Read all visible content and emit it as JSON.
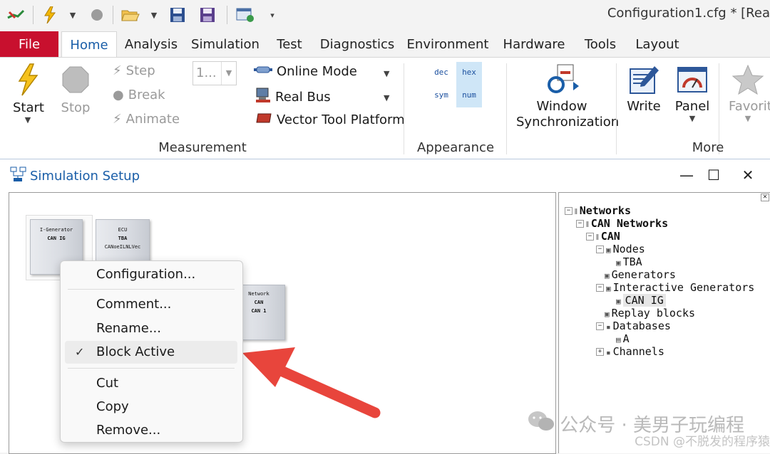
{
  "window": {
    "title": "Configuration1.cfg * [Rea"
  },
  "ribbon_tabs": [
    "File",
    "Home",
    "Analysis",
    "Simulation",
    "Test",
    "Diagnostics",
    "Environment",
    "Hardware",
    "Tools",
    "Layout"
  ],
  "measurement": {
    "start": "Start",
    "stop": "Stop",
    "step": "Step",
    "break": "Break",
    "animate": "Animate",
    "step_value": "1...",
    "online_mode": "Online Mode",
    "real_bus": "Real Bus",
    "vector_tool_platform": "Vector Tool Platform",
    "group": "Measurement"
  },
  "appearance": {
    "dec": "dec",
    "hex": "hex",
    "sym": "sym",
    "num": "num",
    "group": "Appearance"
  },
  "more": {
    "window_sync_1": "Window",
    "window_sync_2": "Synchronization",
    "write": "Write",
    "panel": "Panel",
    "favorites": "Favorite",
    "group": "More"
  },
  "sim_window": {
    "title": "Simulation Setup"
  },
  "blocks": {
    "igen": {
      "l1": "I-Generator",
      "l2": "CAN IG"
    },
    "ecu": {
      "l1": "ECU",
      "l2": "TBA",
      "l3": "CANoeILNLVec"
    },
    "network": {
      "l1": "Network",
      "l2": "CAN",
      "l3": "CAN 1"
    }
  },
  "context_menu": {
    "configuration": "Configuration...",
    "comment": "Comment...",
    "rename": "Rename...",
    "block_active": "Block Active",
    "cut": "Cut",
    "copy": "Copy",
    "remove": "Remove..."
  },
  "tree": {
    "networks": "Networks",
    "can_networks": "CAN Networks",
    "can": "CAN",
    "nodes": "Nodes",
    "tba": "TBA",
    "generators": "Generators",
    "interactive_generators": "Interactive Generators",
    "can_ig": "CAN IG",
    "replay_blocks": "Replay blocks",
    "databases": "Databases",
    "db_a": "A",
    "channels": "Channels"
  },
  "watermark": {
    "text": "公众号 · 美男子玩编程",
    "csdn": "CSDN @不脱发的程序猿"
  },
  "colors": {
    "file_tab": "#c8102e",
    "accent": "#1a5ea8",
    "arrow": "#e8453c",
    "appearance_highlight": "#cfe6f7"
  }
}
